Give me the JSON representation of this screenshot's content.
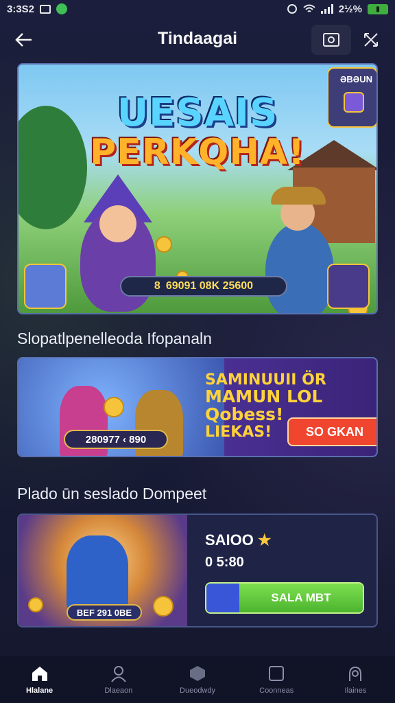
{
  "status_bar": {
    "time": "3:3S2",
    "battery": "2½%"
  },
  "app_bar": {
    "title": "Tindaagai"
  },
  "hero": {
    "title_line1": "UESAIS",
    "title_line2": "PERKQHA!",
    "badge_label": "ƏBƏUN",
    "counter_value": "69091 08K 25600",
    "counter_prefix": "8"
  },
  "section1": {
    "title": "Slopatlpenelleoda Ifopanaln",
    "promo": {
      "line1": "SAMINUUII ÖR",
      "line2": "MAMUN LOL Qobess!",
      "line3": "LIEKAS!",
      "counter": "280977 ‹ 890",
      "button_label": "SO GKAN"
    }
  },
  "section2": {
    "title": "Plado ūn seslado Dompeet",
    "card": {
      "name": "SAIOO",
      "time": "0 5:80",
      "counter": "BEF 291 0BE",
      "button_label": "SALA MBT"
    }
  },
  "bottom_nav": {
    "items": [
      {
        "label": "Hlalane",
        "icon": "home-icon",
        "active": true
      },
      {
        "label": "Dlaeaon",
        "icon": "user-icon",
        "active": false
      },
      {
        "label": "Dueodwdy",
        "icon": "hexagon-icon",
        "active": false
      },
      {
        "label": "Coonneas",
        "icon": "square-icon",
        "active": false
      },
      {
        "label": "Ilaines",
        "icon": "profile-icon",
        "active": false
      }
    ]
  },
  "colors": {
    "background": "#171a36",
    "accent_gold": "#f6c43b",
    "cta_red": "#f0452e",
    "cta_green": "#4bb42e"
  }
}
